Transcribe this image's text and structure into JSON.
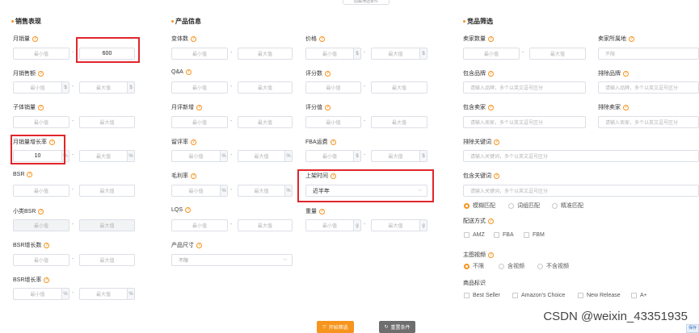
{
  "top_tab": "隐藏筛选条件",
  "sections": {
    "sales": "销售表现",
    "product": "产品信息",
    "competitor": "竞品筛选"
  },
  "placeholders": {
    "min": "最小值",
    "max": "最大值",
    "unlimited": "不限",
    "brand": "请输入品牌，多个以英文逗号区分",
    "seller": "请输入卖家，多个以英文逗号区分",
    "keyword": "请输入关键词，多个以英文逗号区分"
  },
  "units": {
    "dollar": "$",
    "percent": "%",
    "gram": "g"
  },
  "sales_fields": {
    "monthly_sales": {
      "label": "月销量",
      "max_value": "600"
    },
    "monthly_revenue": {
      "label": "月销售额"
    },
    "sub_sales": {
      "label": "子体销量"
    },
    "sales_growth": {
      "label": "月销量增长率",
      "min_value": "10"
    },
    "bsr": {
      "label": "BSR"
    },
    "sub_bsr": {
      "label": "小类BSR"
    },
    "bsr_growth_count": {
      "label": "BSR增长数"
    },
    "bsr_growth_rate": {
      "label": "BSR增长率"
    }
  },
  "product_fields": {
    "variants": {
      "label": "变体数"
    },
    "qa": {
      "label": "Q&A"
    },
    "monthly_new_reviews": {
      "label": "月评新增"
    },
    "review_rate": {
      "label": "留评率"
    },
    "gross_margin": {
      "label": "毛利率"
    },
    "lqs": {
      "label": "LQS"
    },
    "size": {
      "label": "产品尺寸",
      "value": "不限"
    },
    "price": {
      "label": "价格"
    },
    "review_count": {
      "label": "评分数"
    },
    "rating": {
      "label": "评分值"
    },
    "fba_fee": {
      "label": "FBA运费"
    },
    "listing_time": {
      "label": "上架时间",
      "value": "近半年"
    },
    "weight": {
      "label": "重量"
    }
  },
  "competitor_fields": {
    "seller_count": {
      "label": "卖家数量"
    },
    "seller_location": {
      "label": "卖家所属地",
      "value": "不限"
    },
    "include_brand": {
      "label": "包含品牌"
    },
    "exclude_brand": {
      "label": "排除品牌"
    },
    "include_seller": {
      "label": "包含卖家"
    },
    "exclude_seller": {
      "label": "排除卖家"
    },
    "exclude_keyword": {
      "label": "排除关键词"
    },
    "include_keyword": {
      "label": "包含关键词"
    },
    "match_options": [
      "模糊匹配",
      "词组匹配",
      "精准匹配"
    ],
    "fulfillment": {
      "label": "配送方式",
      "options": [
        "AMZ",
        "FBA",
        "FBM"
      ]
    },
    "video": {
      "label": "主图视频",
      "options": [
        "不限",
        "含视频",
        "不含视频"
      ]
    },
    "badges": {
      "label": "商品标识",
      "options": [
        "Best Seller",
        "Amazon's Choice",
        "New Release",
        "A+"
      ]
    }
  },
  "buttons": {
    "start": "开始筛选",
    "reset": "重置条件"
  },
  "watermark": "CSDN @weixin_43351935",
  "corner_tag": "保存",
  "colors": {
    "accent": "#f7941d",
    "highlight_box": "#e0262c",
    "reset_button": "#6e6e6e"
  }
}
